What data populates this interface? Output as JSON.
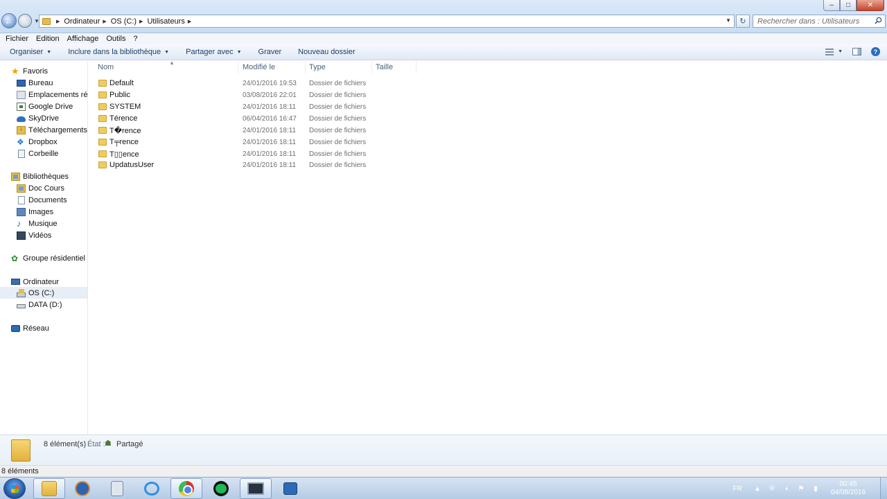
{
  "window": {
    "controls": {
      "minimize": "–",
      "maximize": "□",
      "close": "✕"
    }
  },
  "address": {
    "crumbs": [
      "Ordinateur",
      "OS (C:)",
      "Utilisateurs"
    ],
    "search_placeholder": "Rechercher dans : Utilisateurs"
  },
  "menubar": {
    "items": [
      "Fichier",
      "Edition",
      "Affichage",
      "Outils",
      "?"
    ]
  },
  "commandbar": {
    "items": [
      "Organiser",
      "Inclure dans la bibliothèque",
      "Partager avec",
      "Graver",
      "Nouveau dossier"
    ]
  },
  "navpane": {
    "favorites": {
      "label": "Favoris",
      "items": [
        "Bureau",
        "Emplacements récer",
        "Google Drive",
        "SkyDrive",
        "Téléchargements",
        "Dropbox",
        "Corbeille"
      ]
    },
    "libraries": {
      "label": "Bibliothèques",
      "items": [
        "Doc Cours",
        "Documents",
        "Images",
        "Musique",
        "Vidéos"
      ]
    },
    "homegroup": {
      "label": "Groupe résidentiel"
    },
    "computer": {
      "label": "Ordinateur",
      "items": [
        "OS (C:)",
        "DATA (D:)"
      ]
    },
    "network": {
      "label": "Réseau"
    }
  },
  "columns": [
    "Nom",
    "Modifié le",
    "Type",
    "Taille"
  ],
  "files": [
    {
      "name": "Default",
      "date": "24/01/2016 19:53",
      "type": "Dossier de fichiers"
    },
    {
      "name": "Public",
      "date": "03/08/2016 22:01",
      "type": "Dossier de fichiers"
    },
    {
      "name": "SYSTEM",
      "date": "24/01/2016 18:11",
      "type": "Dossier de fichiers"
    },
    {
      "name": "Térence",
      "date": "06/04/2016 16:47",
      "type": "Dossier de fichiers"
    },
    {
      "name": "T�rence",
      "date": "24/01/2016 18:11",
      "type": "Dossier de fichiers"
    },
    {
      "name": "T╤rence",
      "date": "24/01/2016 18:11",
      "type": "Dossier de fichiers"
    },
    {
      "name": "T▯▯ence",
      "date": "24/01/2016 18:11",
      "type": "Dossier de fichiers"
    },
    {
      "name": "UpdatusUser",
      "date": "24/01/2016 18:11",
      "type": "Dossier de fichiers"
    }
  ],
  "details": {
    "count": "8 élément(s)",
    "state_label": "État :",
    "state_value": "Partagé"
  },
  "statusbar": {
    "text": "8 éléments"
  },
  "taskbar": {
    "apps": [
      "explorer-icon",
      "media-player-icon",
      "calculator-icon",
      "internet-explorer-icon",
      "chrome-icon",
      "spotify-icon",
      "screen-app-icon",
      "network-app-icon"
    ],
    "language": "FR",
    "time": "00:45",
    "date": "04/08/2016"
  }
}
